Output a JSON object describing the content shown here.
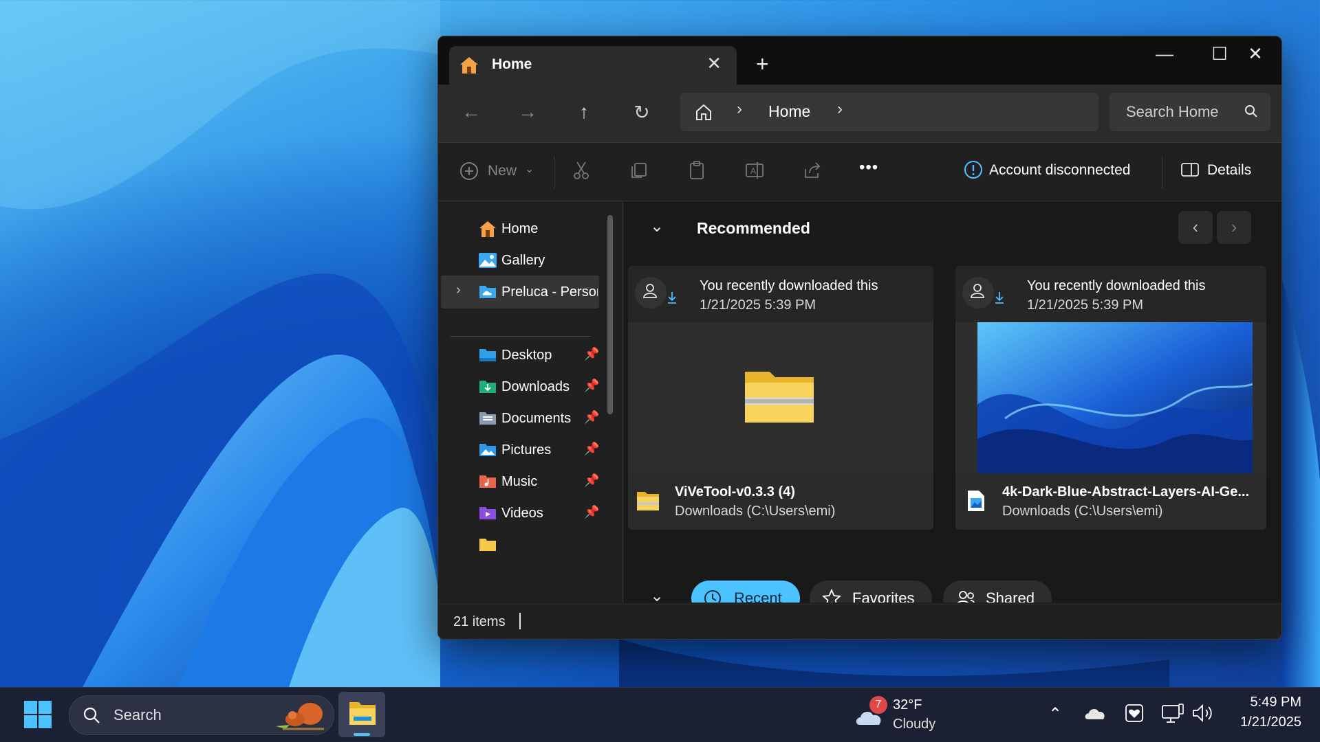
{
  "window": {
    "tab_title": "Home",
    "new_tab": "+",
    "close_tab": "✕",
    "minimize": "—",
    "maximize": "☐",
    "close": "✕"
  },
  "nav": {
    "breadcrumb": [
      "Home"
    ],
    "search_placeholder": "Search Home"
  },
  "toolbar": {
    "new_label": "New",
    "more": "•••",
    "account_status": "Account disconnected",
    "details_label": "Details"
  },
  "sidebar": {
    "top_items": [
      {
        "label": "Home",
        "icon": "home-icon"
      },
      {
        "label": "Gallery",
        "icon": "gallery-icon"
      },
      {
        "label": "Preluca - Personal",
        "icon": "onedrive-icon",
        "selected": true
      }
    ],
    "pinned_items": [
      {
        "label": "Desktop",
        "icon": "desktop-folder-icon"
      },
      {
        "label": "Downloads",
        "icon": "downloads-folder-icon"
      },
      {
        "label": "Documents",
        "icon": "documents-folder-icon"
      },
      {
        "label": "Pictures",
        "icon": "pictures-folder-icon"
      },
      {
        "label": "Music",
        "icon": "music-folder-icon"
      },
      {
        "label": "Videos",
        "icon": "videos-folder-icon"
      }
    ]
  },
  "content": {
    "recommended_title": "Recommended",
    "cards": [
      {
        "activity": "You recently downloaded this",
        "date": "1/21/2025 5:39 PM",
        "name": "ViVeTool-v0.3.3 (4)",
        "path": "Downloads (C:\\Users\\emi)"
      },
      {
        "activity": "You recently downloaded this",
        "date": "1/21/2025 5:39 PM",
        "name": "4k-Dark-Blue-Abstract-Layers-AI-Ge...",
        "path": "Downloads (C:\\Users\\emi)"
      }
    ],
    "filters": [
      "Recent",
      "Favorites",
      "Shared"
    ],
    "active_filter": "Recent"
  },
  "status": {
    "item_count": "21 items"
  },
  "taskbar": {
    "search_label": "Search",
    "weather": {
      "badge": "7",
      "temp": "32°F",
      "condition": "Cloudy"
    },
    "clock": {
      "time": "5:49 PM",
      "date": "1/21/2025"
    }
  },
  "colors": {
    "accent": "#4cc2ff",
    "window_bg": "#202020",
    "folder": "#f7c948"
  }
}
